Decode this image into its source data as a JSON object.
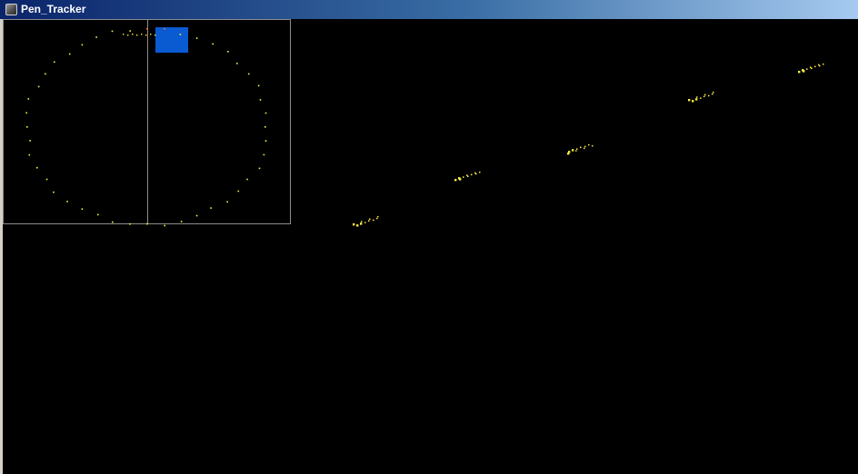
{
  "window": {
    "title": "Pen_Tracker"
  },
  "colors": {
    "titlebar_start": "#0a246a",
    "titlebar_end": "#a6caf0",
    "canvas_bg": "#000000",
    "inset_border": "#8c8c8c",
    "marker": "#0a5ad2",
    "track_dots": "#ffee44",
    "highlight_dots": "#ff6a3a"
  },
  "icons": {
    "app": "app-window-icon"
  }
}
